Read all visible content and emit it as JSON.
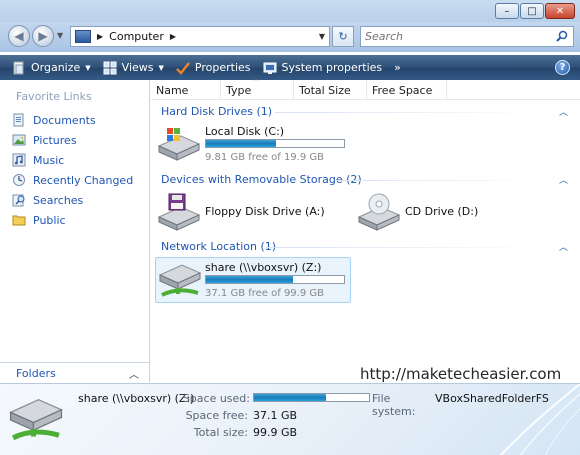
{
  "window": {
    "minimize": "–",
    "maximize": "□",
    "close": "✕"
  },
  "address": {
    "path": "Computer",
    "search_placeholder": "Search"
  },
  "toolbar": {
    "organize": "Organize",
    "views": "Views",
    "properties": "Properties",
    "system_properties": "System properties",
    "more": "»",
    "help": "?"
  },
  "sidebar": {
    "title": "Favorite Links",
    "items": [
      {
        "label": "Documents",
        "icon": "documents-icon"
      },
      {
        "label": "Pictures",
        "icon": "pictures-icon"
      },
      {
        "label": "Music",
        "icon": "music-icon"
      },
      {
        "label": "Recently Changed",
        "icon": "recently-changed-icon"
      },
      {
        "label": "Searches",
        "icon": "searches-icon"
      },
      {
        "label": "Public",
        "icon": "public-icon"
      }
    ],
    "folders": "Folders"
  },
  "columns": [
    "Name",
    "Type",
    "Total Size",
    "Free Space"
  ],
  "groups": {
    "hdd": "Hard Disk Drives (1)",
    "removable": "Devices with Removable Storage (2)",
    "network": "Network Location (1)"
  },
  "drives": {
    "local": {
      "name": "Local Disk (C:)",
      "free": "9.81 GB free of 19.9 GB",
      "used_fraction": 0.51
    },
    "floppy": {
      "name": "Floppy Disk Drive (A:)"
    },
    "cd": {
      "name": "CD Drive (D:)"
    },
    "share": {
      "name": "share (\\\\vboxsvr) (Z:)",
      "free": "37.1 GB free of 99.9 GB",
      "used_fraction": 0.63
    }
  },
  "watermark": "http://maketecheasier.com",
  "details": {
    "title": "share (\\\\vboxsvr) (Z:)",
    "space_used_label": "Space used:",
    "space_free_label": "Space free:",
    "space_free": "37.1 GB",
    "total_size_label": "Total size:",
    "total_size": "99.9 GB",
    "filesystem_label": "File system:",
    "filesystem": "VBoxSharedFolderFS",
    "used_fraction": 0.63
  },
  "colors": {
    "link_blue": "#1f56b2",
    "toolbar": "#2e4f77",
    "bar_fill": "#1c7ab8"
  }
}
